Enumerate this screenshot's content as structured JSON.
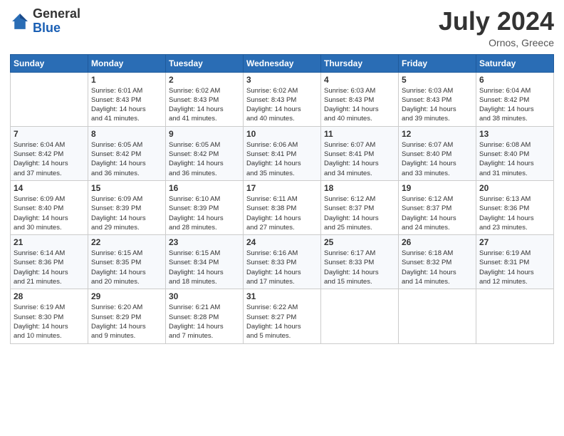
{
  "header": {
    "logo_general": "General",
    "logo_blue": "Blue",
    "month_year": "July 2024",
    "location": "Ornos, Greece"
  },
  "weekdays": [
    "Sunday",
    "Monday",
    "Tuesday",
    "Wednesday",
    "Thursday",
    "Friday",
    "Saturday"
  ],
  "weeks": [
    [
      {
        "day": "",
        "info": ""
      },
      {
        "day": "1",
        "info": "Sunrise: 6:01 AM\nSunset: 8:43 PM\nDaylight: 14 hours\nand 41 minutes."
      },
      {
        "day": "2",
        "info": "Sunrise: 6:02 AM\nSunset: 8:43 PM\nDaylight: 14 hours\nand 41 minutes."
      },
      {
        "day": "3",
        "info": "Sunrise: 6:02 AM\nSunset: 8:43 PM\nDaylight: 14 hours\nand 40 minutes."
      },
      {
        "day": "4",
        "info": "Sunrise: 6:03 AM\nSunset: 8:43 PM\nDaylight: 14 hours\nand 40 minutes."
      },
      {
        "day": "5",
        "info": "Sunrise: 6:03 AM\nSunset: 8:43 PM\nDaylight: 14 hours\nand 39 minutes."
      },
      {
        "day": "6",
        "info": "Sunrise: 6:04 AM\nSunset: 8:42 PM\nDaylight: 14 hours\nand 38 minutes."
      }
    ],
    [
      {
        "day": "7",
        "info": "Sunrise: 6:04 AM\nSunset: 8:42 PM\nDaylight: 14 hours\nand 37 minutes."
      },
      {
        "day": "8",
        "info": "Sunrise: 6:05 AM\nSunset: 8:42 PM\nDaylight: 14 hours\nand 36 minutes."
      },
      {
        "day": "9",
        "info": "Sunrise: 6:05 AM\nSunset: 8:42 PM\nDaylight: 14 hours\nand 36 minutes."
      },
      {
        "day": "10",
        "info": "Sunrise: 6:06 AM\nSunset: 8:41 PM\nDaylight: 14 hours\nand 35 minutes."
      },
      {
        "day": "11",
        "info": "Sunrise: 6:07 AM\nSunset: 8:41 PM\nDaylight: 14 hours\nand 34 minutes."
      },
      {
        "day": "12",
        "info": "Sunrise: 6:07 AM\nSunset: 8:40 PM\nDaylight: 14 hours\nand 33 minutes."
      },
      {
        "day": "13",
        "info": "Sunrise: 6:08 AM\nSunset: 8:40 PM\nDaylight: 14 hours\nand 31 minutes."
      }
    ],
    [
      {
        "day": "14",
        "info": "Sunrise: 6:09 AM\nSunset: 8:40 PM\nDaylight: 14 hours\nand 30 minutes."
      },
      {
        "day": "15",
        "info": "Sunrise: 6:09 AM\nSunset: 8:39 PM\nDaylight: 14 hours\nand 29 minutes."
      },
      {
        "day": "16",
        "info": "Sunrise: 6:10 AM\nSunset: 8:39 PM\nDaylight: 14 hours\nand 28 minutes."
      },
      {
        "day": "17",
        "info": "Sunrise: 6:11 AM\nSunset: 8:38 PM\nDaylight: 14 hours\nand 27 minutes."
      },
      {
        "day": "18",
        "info": "Sunrise: 6:12 AM\nSunset: 8:37 PM\nDaylight: 14 hours\nand 25 minutes."
      },
      {
        "day": "19",
        "info": "Sunrise: 6:12 AM\nSunset: 8:37 PM\nDaylight: 14 hours\nand 24 minutes."
      },
      {
        "day": "20",
        "info": "Sunrise: 6:13 AM\nSunset: 8:36 PM\nDaylight: 14 hours\nand 23 minutes."
      }
    ],
    [
      {
        "day": "21",
        "info": "Sunrise: 6:14 AM\nSunset: 8:36 PM\nDaylight: 14 hours\nand 21 minutes."
      },
      {
        "day": "22",
        "info": "Sunrise: 6:15 AM\nSunset: 8:35 PM\nDaylight: 14 hours\nand 20 minutes."
      },
      {
        "day": "23",
        "info": "Sunrise: 6:15 AM\nSunset: 8:34 PM\nDaylight: 14 hours\nand 18 minutes."
      },
      {
        "day": "24",
        "info": "Sunrise: 6:16 AM\nSunset: 8:33 PM\nDaylight: 14 hours\nand 17 minutes."
      },
      {
        "day": "25",
        "info": "Sunrise: 6:17 AM\nSunset: 8:33 PM\nDaylight: 14 hours\nand 15 minutes."
      },
      {
        "day": "26",
        "info": "Sunrise: 6:18 AM\nSunset: 8:32 PM\nDaylight: 14 hours\nand 14 minutes."
      },
      {
        "day": "27",
        "info": "Sunrise: 6:19 AM\nSunset: 8:31 PM\nDaylight: 14 hours\nand 12 minutes."
      }
    ],
    [
      {
        "day": "28",
        "info": "Sunrise: 6:19 AM\nSunset: 8:30 PM\nDaylight: 14 hours\nand 10 minutes."
      },
      {
        "day": "29",
        "info": "Sunrise: 6:20 AM\nSunset: 8:29 PM\nDaylight: 14 hours\nand 9 minutes."
      },
      {
        "day": "30",
        "info": "Sunrise: 6:21 AM\nSunset: 8:28 PM\nDaylight: 14 hours\nand 7 minutes."
      },
      {
        "day": "31",
        "info": "Sunrise: 6:22 AM\nSunset: 8:27 PM\nDaylight: 14 hours\nand 5 minutes."
      },
      {
        "day": "",
        "info": ""
      },
      {
        "day": "",
        "info": ""
      },
      {
        "day": "",
        "info": ""
      }
    ]
  ]
}
